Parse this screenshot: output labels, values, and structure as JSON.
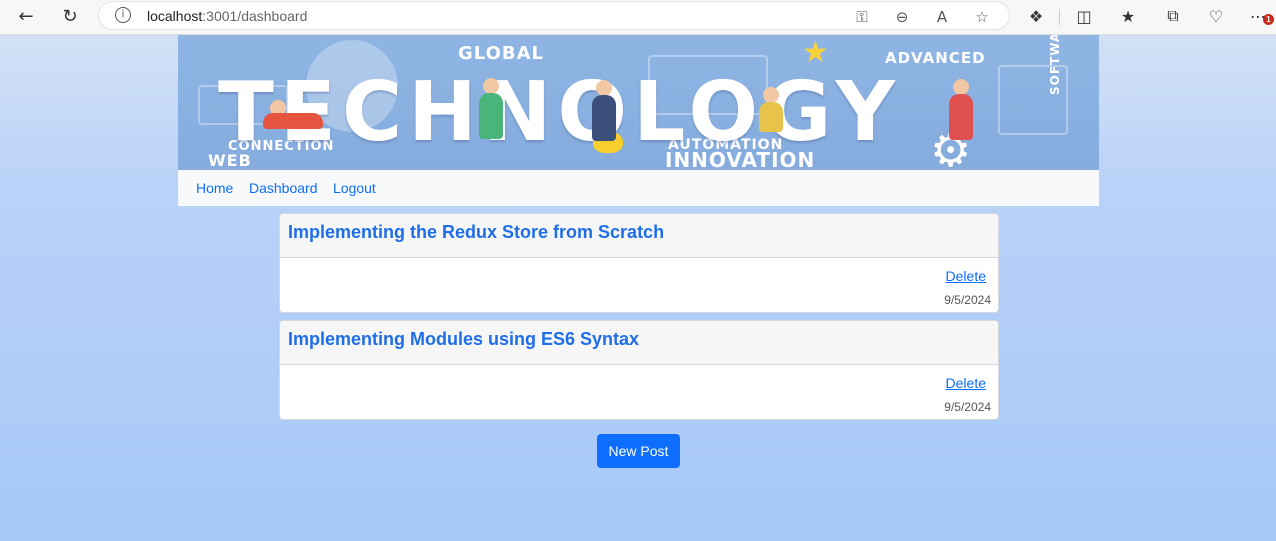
{
  "browser": {
    "url_host": "localhost",
    "url_path": ":3001/dashboard",
    "notification_count": "1"
  },
  "banner": {
    "main_word": "TECHNOLOGY",
    "words": {
      "global": "GLOBAL",
      "advanced": "ADVANCED",
      "connection": "CONNECTION",
      "web": "WEB",
      "automation": "AUTOMATION",
      "innovation": "INNOVATION",
      "software": "SOFTWARE"
    }
  },
  "nav": {
    "home": "Home",
    "dashboard": "Dashboard",
    "logout": "Logout"
  },
  "posts": [
    {
      "title": "Implementing the Redux Store from Scratch",
      "delete_label": "Delete",
      "date": "9/5/2024"
    },
    {
      "title": "Implementing Modules using ES6 Syntax",
      "delete_label": "Delete",
      "date": "9/5/2024"
    }
  ],
  "actions": {
    "new_post": "New Post"
  },
  "colors": {
    "link": "#0d6efd",
    "title": "#1e6ee8",
    "button": "#0d6efd"
  }
}
